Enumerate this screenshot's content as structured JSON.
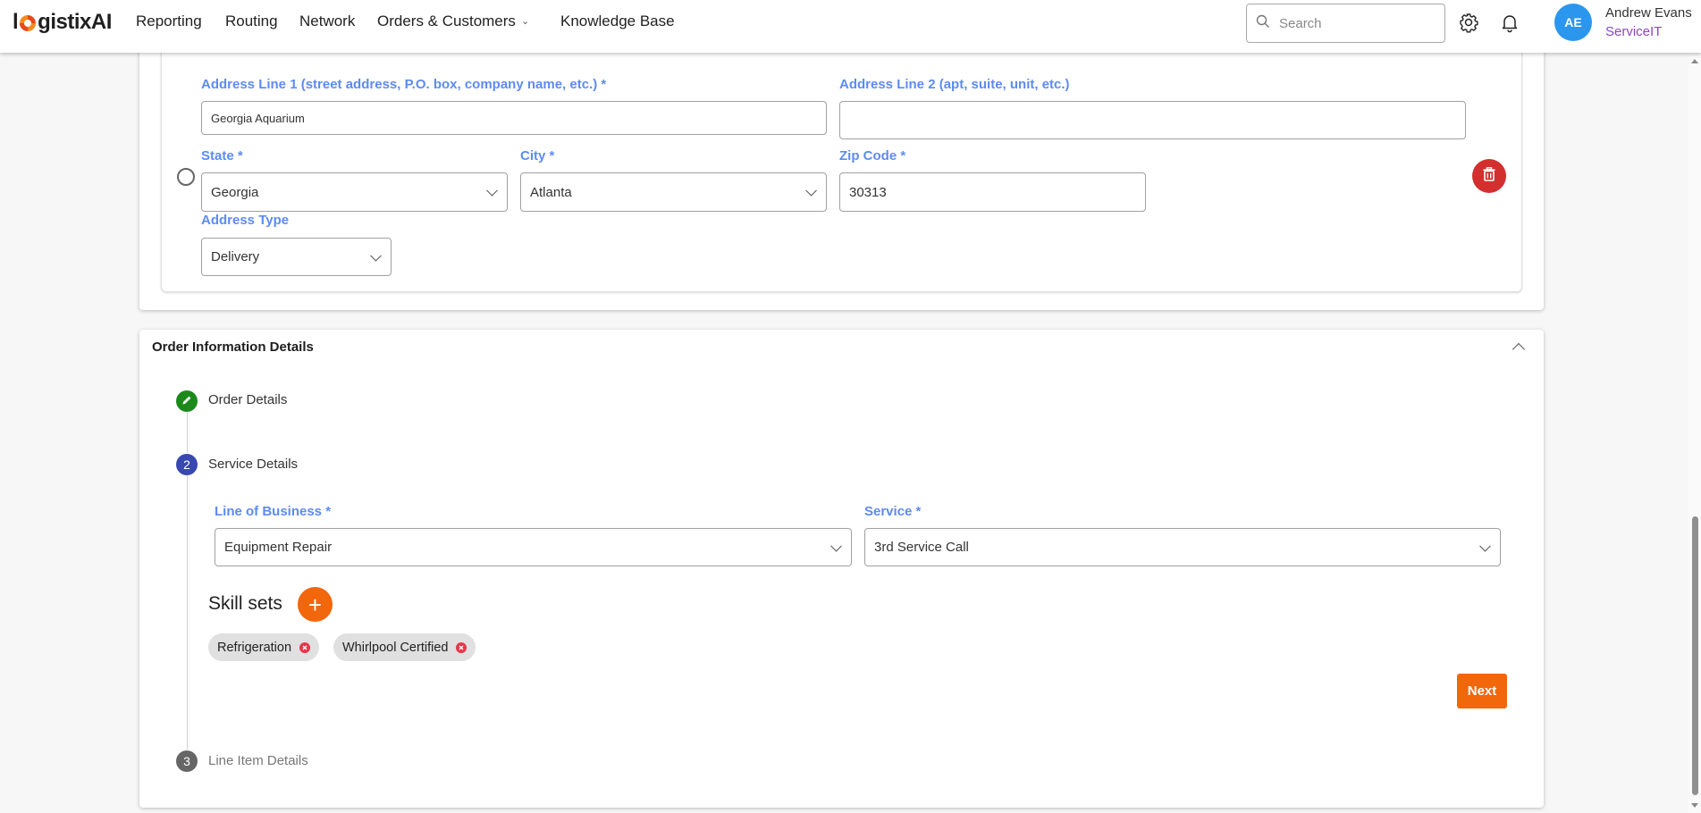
{
  "header": {
    "logo_prefix": "l",
    "logo_suffix": "gistixAI",
    "nav": [
      {
        "label": "Reporting"
      },
      {
        "label": "Routing"
      },
      {
        "label": "Network"
      },
      {
        "label": "Orders & Customers",
        "has_dropdown": true
      },
      {
        "label": "Knowledge Base"
      }
    ],
    "search_placeholder": "Search",
    "search_value": "",
    "icons": [
      "search-icon",
      "gear-icon",
      "bell-icon"
    ],
    "user": {
      "initials": "AE",
      "name": "Andrew Evans",
      "org": "ServiceIT"
    }
  },
  "address": {
    "line1_label": "Address Line 1 (street address, P.O. box, company name, etc.) *",
    "line1_value": "Georgia Aquarium",
    "line2_label": "Address Line 2 (apt, suite, unit, etc.)",
    "line2_value": "",
    "state_label": "State *",
    "state_value": "Georgia",
    "city_label": "City *",
    "city_value": "Atlanta",
    "zip_label": "Zip Code *",
    "zip_value": "30313",
    "type_label": "Address Type",
    "type_value": "Delivery",
    "selected": false
  },
  "order_info": {
    "title": "Order Information Details",
    "expanded": true,
    "steps": [
      {
        "number": "1",
        "label": "Order Details",
        "status": "completed",
        "icon": "pencil-icon"
      },
      {
        "number": "2",
        "label": "Service Details",
        "status": "active"
      },
      {
        "number": "3",
        "label": "Line Item Details",
        "status": "pending"
      }
    ],
    "service_details": {
      "lob_label": "Line of Business *",
      "lob_value": "Equipment Repair",
      "service_label": "Service *",
      "service_value": "3rd Service Call",
      "skill_sets_title": "Skill sets",
      "skill_sets": [
        "Refrigeration",
        "Whirlpool Certified"
      ],
      "next_label": "Next"
    }
  },
  "colors": {
    "accent_orange": "#f2660c",
    "label_blue": "#5d8bf4",
    "step_completed": "#1b8a1b",
    "step_active": "#3848b0",
    "step_pending": "#666666",
    "delete_red": "#d32f2f",
    "avatar_blue": "#2b96ee",
    "org_purple": "#8e44c6"
  }
}
